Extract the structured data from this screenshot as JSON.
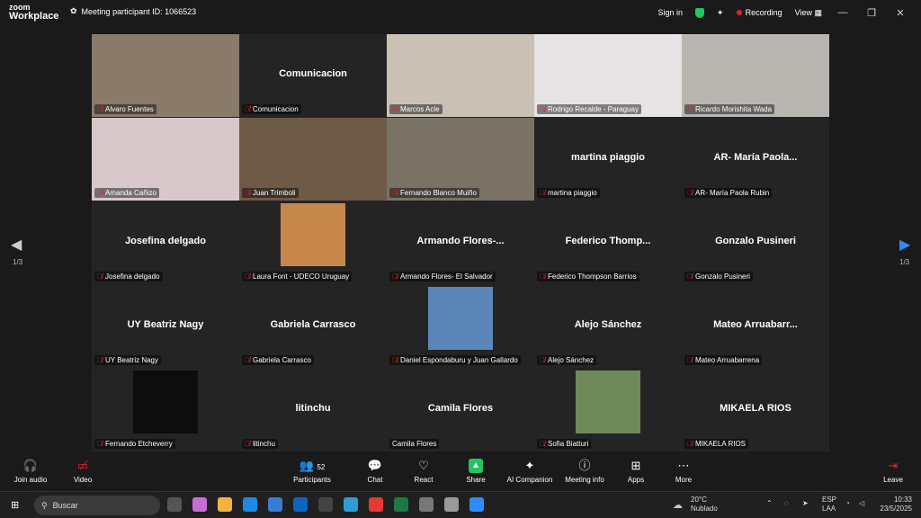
{
  "titlebar": {
    "logo_line1": "zoom",
    "logo_line2": "Workplace",
    "meeting_id": "Meeting participant ID: 1066523",
    "sign_in": "Sign in",
    "recording": "Recording",
    "view": "View"
  },
  "nav": {
    "page_left": "1/3",
    "page_right": "1/3"
  },
  "tiles": [
    {
      "label": "Alvaro Fuentes",
      "bigname": "",
      "video": true,
      "bg": "#8a7a6a"
    },
    {
      "label": "Comunicacion",
      "bigname": "Comunicacion",
      "video": false,
      "bg": "#242424"
    },
    {
      "label": "Marcos Acle",
      "bigname": "",
      "video": true,
      "bg": "#c9c1b3"
    },
    {
      "label": "Rodrigo Recalde - Paraguay",
      "bigname": "",
      "video": true,
      "bg": "#e8e4e6"
    },
    {
      "label": "Ricardo Morishita Wada",
      "bigname": "",
      "video": true,
      "bg": "#b9b5b0"
    },
    {
      "label": "Amanda Cañizo",
      "bigname": "",
      "video": true,
      "bg": "#d8c8cc"
    },
    {
      "label": "Juan Trimboli",
      "bigname": "",
      "video": true,
      "bg": "#6e5a46"
    },
    {
      "label": "Fernando Blanco Muiño",
      "bigname": "",
      "video": true,
      "bg": "#7b7266"
    },
    {
      "label": "martina piaggio",
      "bigname": "martina piaggio",
      "video": false,
      "bg": "#242424"
    },
    {
      "label": "AR- María Paola Rubin",
      "bigname": "AR- María Paola...",
      "video": false,
      "bg": "#242424"
    },
    {
      "label": "Josefina delgado",
      "bigname": "Josefina delgado",
      "video": false,
      "bg": "#242424"
    },
    {
      "label": "Laura Font - UDECO Uruguay",
      "bigname": "",
      "video": false,
      "avatar": "#c7874a",
      "bg": "#242424"
    },
    {
      "label": "Armando Flores- El Salvador",
      "bigname": "Armando Flores-...",
      "video": false,
      "bg": "#242424"
    },
    {
      "label": "Federico Thompson Barrios",
      "bigname": "Federico Thomp...",
      "video": false,
      "bg": "#242424"
    },
    {
      "label": "Gonzalo Pusineri",
      "bigname": "Gonzalo Pusineri",
      "video": false,
      "bg": "#242424"
    },
    {
      "label": "UY Beatriz Nagy",
      "bigname": "UY Beatriz Nagy",
      "video": false,
      "bg": "#242424"
    },
    {
      "label": "Gabriela Carrasco",
      "bigname": "Gabriela Carrasco",
      "video": false,
      "bg": "#242424"
    },
    {
      "label": "Daniel Espondaburu y Juan Gallardo",
      "bigname": "",
      "video": false,
      "avatar": "#5a86b8",
      "bg": "#242424"
    },
    {
      "label": "Alejo Sánchez",
      "bigname": "Alejo Sánchez",
      "video": false,
      "bg": "#242424"
    },
    {
      "label": "Mateo Arruabarrena",
      "bigname": "Mateo Arruabarr...",
      "video": false,
      "bg": "#242424"
    },
    {
      "label": "Fernando Etcheverry",
      "bigname": "",
      "video": false,
      "avatar": "#0d0d0d",
      "bg": "#242424"
    },
    {
      "label": "litinchu",
      "bigname": "litinchu",
      "video": false,
      "bg": "#242424"
    },
    {
      "label": "Camila Flores",
      "bigname": "Camila Flores",
      "video": false,
      "bg": "#242424",
      "nomute": true
    },
    {
      "label": "Sofia Biatturi",
      "bigname": "",
      "video": false,
      "avatar": "#6f8a5a",
      "bg": "#242424"
    },
    {
      "label": "MIKAELA RIOS",
      "bigname": "MIKAELA RIOS",
      "video": false,
      "bg": "#242424"
    }
  ],
  "toolbar": {
    "join_audio": "Join audio",
    "video": "Video",
    "participants": "Participants",
    "participants_count": "52",
    "chat": "Chat",
    "react": "React",
    "share": "Share",
    "ai_companion": "AI Companion",
    "meeting_info": "Meeting info",
    "apps": "Apps",
    "more": "More",
    "leave": "Leave"
  },
  "taskbar": {
    "search_placeholder": "Buscar",
    "weather_temp": "20°C",
    "weather_desc": "Nublado",
    "lang1": "ESP",
    "lang2": "LAA",
    "time": "10:33",
    "date": "23/5/2025"
  },
  "colors": {
    "accent_green": "#35d07f",
    "brand_blue": "#2d8cff",
    "mute_red": "#e02424"
  }
}
